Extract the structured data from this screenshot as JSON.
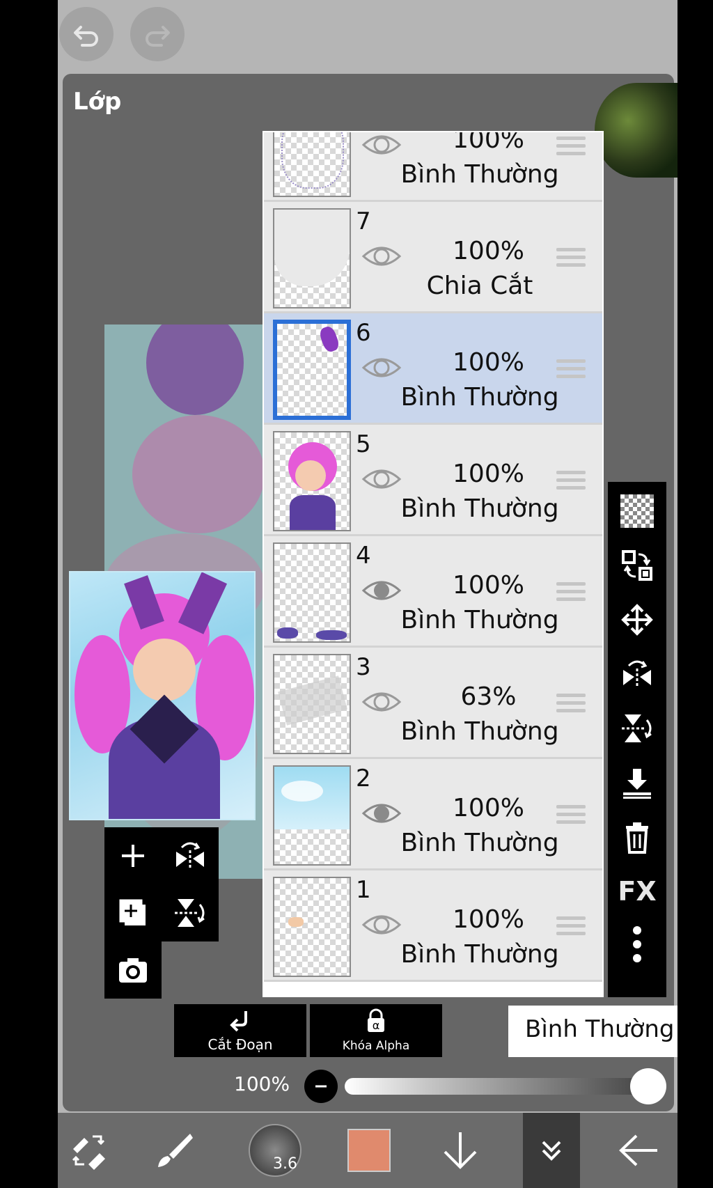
{
  "panel": {
    "title": "Lớp"
  },
  "layers": [
    {
      "number": "",
      "opacity": "100%",
      "blend": "Bình Thường",
      "selected": false
    },
    {
      "number": "7",
      "opacity": "100%",
      "blend": "Chia Cắt",
      "selected": false
    },
    {
      "number": "6",
      "opacity": "100%",
      "blend": "Bình Thường",
      "selected": true
    },
    {
      "number": "5",
      "opacity": "100%",
      "blend": "Bình Thường",
      "selected": false
    },
    {
      "number": "4",
      "opacity": "100%",
      "blend": "Bình Thường",
      "selected": false
    },
    {
      "number": "3",
      "opacity": "63%",
      "blend": "Bình Thường",
      "selected": false
    },
    {
      "number": "2",
      "opacity": "100%",
      "blend": "Bình Thường",
      "selected": false
    },
    {
      "number": "1",
      "opacity": "100%",
      "blend": "Bình Thường",
      "selected": false
    }
  ],
  "controls": {
    "clip_label": "Cắt Đoạn",
    "alpha_lock_label": "Khóa Alpha",
    "blend_mode": "Bình Thường",
    "opacity_label": "100%",
    "opacity_value": 1.0
  },
  "side_toolbar": {
    "fx_label": "FX"
  },
  "bottom_bar": {
    "brush_size": "3.6",
    "current_color": "#e08a6d"
  },
  "colors": {
    "selected_row": "#c9d6ec",
    "selection_border": "#2b6fd6"
  }
}
